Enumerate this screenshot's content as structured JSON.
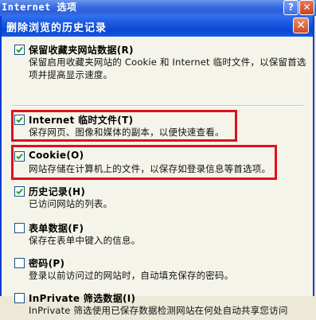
{
  "outer_window": {
    "title": "Internet 选项",
    "help_glyph": "?",
    "close_glyph": "✕"
  },
  "dialog": {
    "title": "删除浏览的历史记录",
    "close_glyph": "✕",
    "items": [
      {
        "label": "保留收藏夹网站数据(R)",
        "checked": true,
        "desc": "保留启用收藏夹网站的 Cookie 和 Internet 临时文件，以保留首选项并提高显示速度。"
      },
      {
        "label": "Internet 临时文件(T)",
        "checked": true,
        "desc": "保存网页、图像和媒体的副本，以便快速查看。"
      },
      {
        "label": "Cookie(O)",
        "checked": true,
        "desc": "网站存储在计算机上的文件，以保存如登录信息等首选项。"
      },
      {
        "label": "历史记录(H)",
        "checked": true,
        "desc": "已访问网站的列表。"
      },
      {
        "label": "表单数据(F)",
        "checked": false,
        "desc": "保存在表单中键入的信息。"
      },
      {
        "label": "密码(P)",
        "checked": false,
        "desc": "登录以前访问过的网站时，自动填充保存的密码。"
      },
      {
        "label": "InPrivate 筛选数据(I)",
        "checked": false,
        "desc": "InPrivate 筛选使用已保存数据检测网站在何处自动共享您访问"
      }
    ]
  },
  "colors": {
    "highlight": "#e0101c",
    "titlebar": "#0a47d2"
  }
}
